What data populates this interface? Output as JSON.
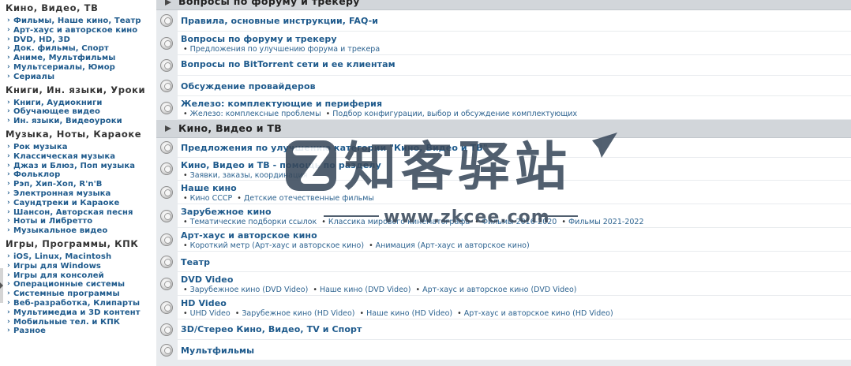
{
  "sidebar": {
    "groups": [
      {
        "title": "Кино, Видео, ТВ",
        "items": [
          "Фильмы, Наше кино, Театр",
          "Арт-хаус и авторское кино",
          "DVD, HD, 3D",
          "Док. фильмы, Спорт",
          "Аниме, Мультфильмы",
          "Мультсериалы, Юмор",
          "Сериалы"
        ]
      },
      {
        "title": "Книги, Ин. языки, Уроки",
        "items": [
          "Книги, Аудиокниги",
          "Обучающее видео",
          "Ин. языки, Видеоуроки"
        ]
      },
      {
        "title": "Музыка, Ноты, Караоке",
        "items": [
          "Рок музыка",
          "Классическая музыка",
          "Джаз и Блюз, Поп музыка",
          "Фольклор",
          "Рэп, Хип-Хоп, R'n'B",
          "Электронная музыка",
          "Саундтреки и Караоке",
          "Шансон, Авторская песня",
          "Ноты и Либретто",
          "Музыкальное видео"
        ]
      },
      {
        "title": "Игры, Программы, КПК",
        "items": [
          "iOS, Linux, Macintosh",
          "Игры для Windows",
          "Игры для консолей",
          "Операционные системы",
          "Системные программы",
          "Веб-разработка, Клипарты",
          "Мультимедиа и 3D контент",
          "Мобильные тел. и КПК",
          "Разное"
        ]
      }
    ]
  },
  "main": {
    "sections": [
      {
        "title": "Вопросы по форуму и трекеру",
        "forums": [
          {
            "name": "Правила, основные инструкции, FAQ-и",
            "subs": []
          },
          {
            "name": "Вопросы по форуму и трекеру",
            "subs": [
              "Предложения по улучшению форума и трекера"
            ]
          },
          {
            "name": "Вопросы по BitTorrent сети и ее клиентам",
            "subs": []
          },
          {
            "name": "Обсуждение провайдеров",
            "subs": []
          },
          {
            "name": "Железо: комплектующие и периферия",
            "subs": [
              "Железо: комплексные проблемы",
              "Подбор конфигурации, выбор и обсуждение комплектующих"
            ]
          }
        ]
      },
      {
        "title": "Кино, Видео и ТВ",
        "forums": [
          {
            "name": "Предложения по улучшению категории \"Кино, Видео и ТВ\"",
            "subs": []
          },
          {
            "name": "Кино, Видео и ТВ - помощь по разделу",
            "subs": [
              "Заявки, заказы, координация"
            ]
          },
          {
            "name": "Наше кино",
            "subs": [
              "Кино СССР",
              "Детские отечественные фильмы"
            ]
          },
          {
            "name": "Зарубежное кино",
            "subs": [
              "Тематические подборки ссылок",
              "Классика мирового кинематографа",
              "Фильмы 2016-2020",
              "Фильмы 2021-2022"
            ]
          },
          {
            "name": "Арт-хаус и авторское кино",
            "subs": [
              "Короткий метр (Арт-хаус и авторское кино)",
              "Анимация (Арт-хаус и авторское кино)"
            ]
          },
          {
            "name": "Театр",
            "subs": []
          },
          {
            "name": "DVD Video",
            "subs": [
              "Зарубежное кино (DVD Video)",
              "Наше кино (DVD Video)",
              "Арт-хаус и авторское кино (DVD Video)"
            ]
          },
          {
            "name": "HD Video",
            "subs": [
              "UHD Video",
              "Зарубежное кино (HD Video)",
              "Наше кино (HD Video)",
              "Арт-хаус и авторское кино (HD Video)"
            ]
          },
          {
            "name": "3D/Стерео Кино, Видео, TV и Спорт",
            "subs": []
          },
          {
            "name": "Мультфильмы",
            "subs": []
          }
        ]
      }
    ]
  },
  "watermark": {
    "brand": "知客驿站",
    "url": "www.zkcee.com",
    "colors": {
      "mark": "#3a4a5c"
    }
  }
}
